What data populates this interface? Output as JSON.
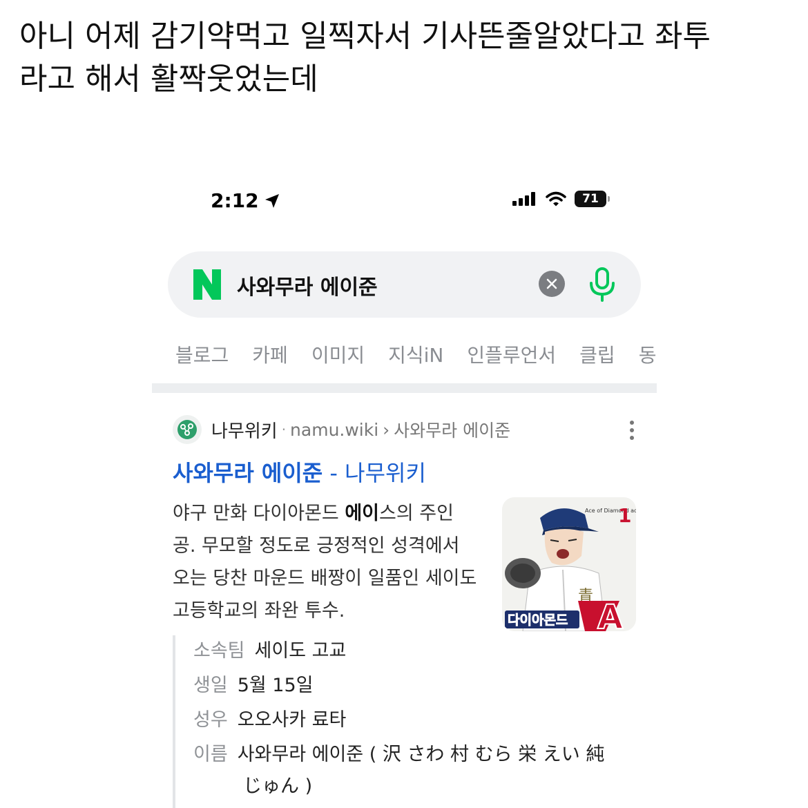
{
  "post": {
    "line1": "아니 어제 감기약먹고 일찍자서 기사뜬줄알았다고 좌투",
    "line2": "라고 해서 활짝웃었는데"
  },
  "status_bar": {
    "time": "2:12",
    "battery": "71",
    "icons": [
      "location-arrow-icon",
      "cellular-signal-icon",
      "wifi-icon",
      "battery-icon"
    ]
  },
  "search": {
    "logo": "N",
    "query": "사와무라 에이준",
    "icons": [
      "clear-icon",
      "microphone-icon"
    ]
  },
  "tabs": [
    "블로그",
    "카페",
    "이미지",
    "지식iN",
    "인플루언서",
    "클립",
    "동"
  ],
  "result": {
    "site_name": "나무위키",
    "separator_dot": "·",
    "url": "namu.wiki",
    "breadcrumb_sep": "›",
    "path": "사와무라 에이준",
    "title_main": "사와무라 에이준",
    "title_suffix": " - 나무위키",
    "snippet": {
      "part1": "야구 만화 다이아몬드 ",
      "bold": "에이",
      "part2": "스의 주인 공. 무모할 정도로 긍정적인 성격에서 오는 당찬 마운드 배짱이 일품인 세이도 고등학교의 좌완 투수."
    },
    "thumbnail": {
      "title": "다이아몬드",
      "subtitle": "Ace of Diamond act II",
      "volume": "1"
    }
  },
  "info": {
    "rows": [
      {
        "key": "소속팀",
        "value": "세이도 고교"
      },
      {
        "key": "생일",
        "value": "5월 15일"
      },
      {
        "key": "성우",
        "value": "오오사카 료타"
      },
      {
        "key": "이름",
        "value": "사와무라 에이준 ( 沢 さわ 村 むら 栄 えい 純"
      }
    ],
    "name_continuation": "じゅん )"
  },
  "colors": {
    "naver_green": "#03c75a",
    "link_blue": "#1a5ecf",
    "tab_gray": "#8a8d92"
  }
}
